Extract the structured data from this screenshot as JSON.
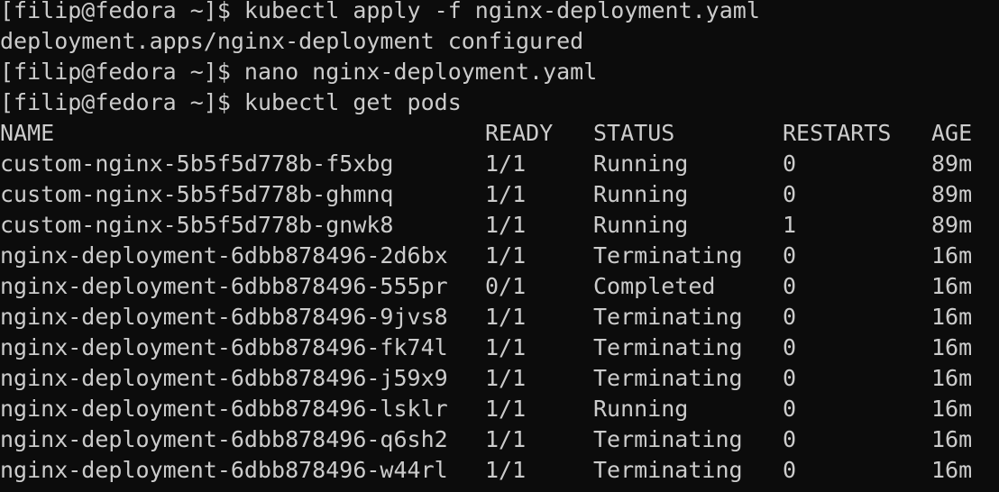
{
  "terminal": {
    "lines": [
      "[filip@fedora ~]$ kubectl apply -f nginx-deployment.yaml",
      "deployment.apps/nginx-deployment configured",
      "[filip@fedora ~]$ nano nginx-deployment.yaml",
      "[filip@fedora ~]$ kubectl get pods"
    ],
    "columns": {
      "name": "NAME",
      "ready": "READY",
      "status": "STATUS",
      "restarts": "RESTARTS",
      "age": "AGE"
    },
    "pods": [
      {
        "name": "custom-nginx-5b5f5d778b-f5xbg",
        "ready": "1/1",
        "status": "Running",
        "restarts": "0",
        "age": "89m"
      },
      {
        "name": "custom-nginx-5b5f5d778b-ghmnq",
        "ready": "1/1",
        "status": "Running",
        "restarts": "0",
        "age": "89m"
      },
      {
        "name": "custom-nginx-5b5f5d778b-gnwk8",
        "ready": "1/1",
        "status": "Running",
        "restarts": "1",
        "age": "89m"
      },
      {
        "name": "nginx-deployment-6dbb878496-2d6bx",
        "ready": "1/1",
        "status": "Terminating",
        "restarts": "0",
        "age": "16m"
      },
      {
        "name": "nginx-deployment-6dbb878496-555pr",
        "ready": "0/1",
        "status": "Completed",
        "restarts": "0",
        "age": "16m"
      },
      {
        "name": "nginx-deployment-6dbb878496-9jvs8",
        "ready": "1/1",
        "status": "Terminating",
        "restarts": "0",
        "age": "16m"
      },
      {
        "name": "nginx-deployment-6dbb878496-fk74l",
        "ready": "1/1",
        "status": "Terminating",
        "restarts": "0",
        "age": "16m"
      },
      {
        "name": "nginx-deployment-6dbb878496-j59x9",
        "ready": "1/1",
        "status": "Terminating",
        "restarts": "0",
        "age": "16m"
      },
      {
        "name": "nginx-deployment-6dbb878496-lsklr",
        "ready": "1/1",
        "status": "Running",
        "restarts": "0",
        "age": "16m"
      },
      {
        "name": "nginx-deployment-6dbb878496-q6sh2",
        "ready": "1/1",
        "status": "Terminating",
        "restarts": "0",
        "age": "16m"
      },
      {
        "name": "nginx-deployment-6dbb878496-w44rl",
        "ready": "1/1",
        "status": "Terminating",
        "restarts": "0",
        "age": "16m"
      }
    ],
    "colors": {
      "background": "#0c0c0c",
      "foreground": "#cccccc"
    }
  }
}
